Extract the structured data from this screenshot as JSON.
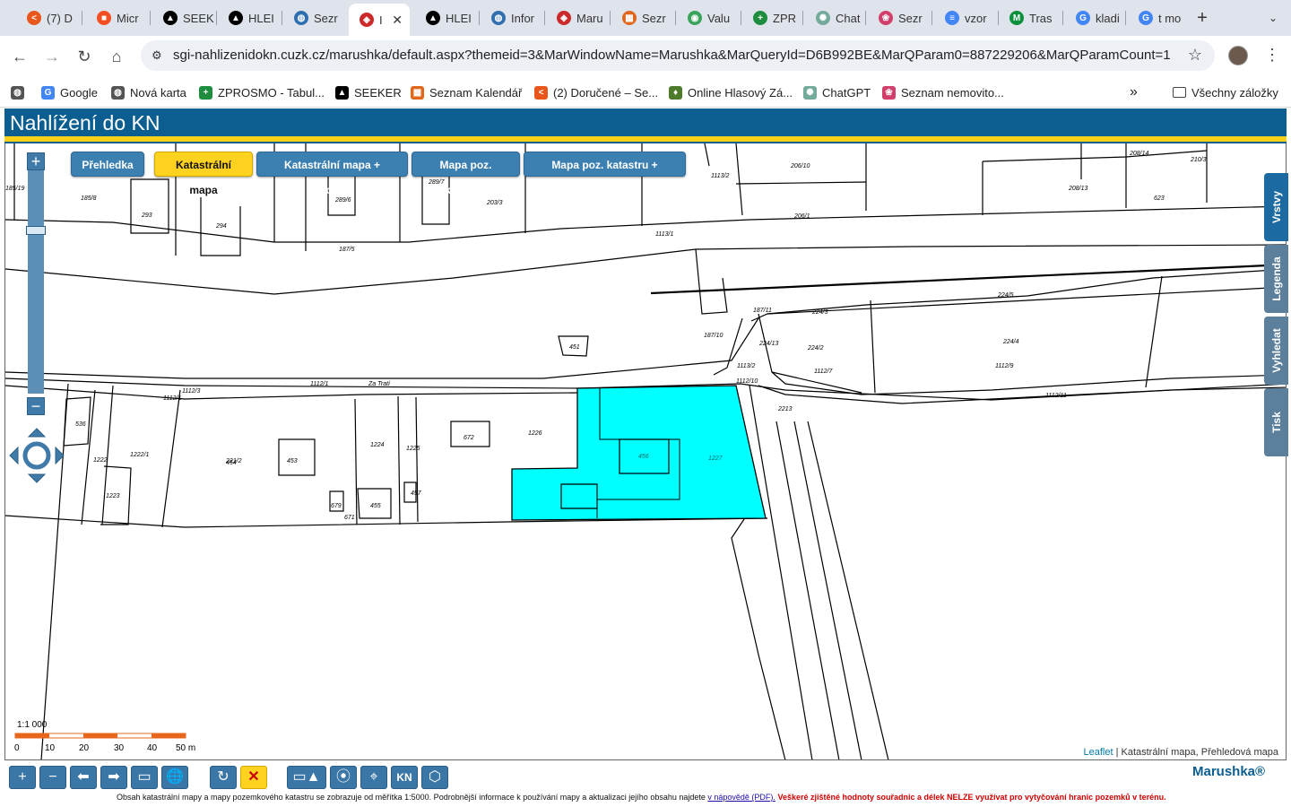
{
  "browser": {
    "tabs": [
      {
        "title": "(7) D",
        "favicon_color": "#e8561b",
        "glyph": "<"
      },
      {
        "title": "Micr",
        "favicon_color": "#f25022",
        "glyph": "■"
      },
      {
        "title": "SEEK",
        "favicon_color": "#000000",
        "glyph": "▲"
      },
      {
        "title": "HLEI",
        "favicon_color": "#000000",
        "glyph": "▲"
      },
      {
        "title": "Sezr",
        "favicon_color": "#2f6fb0",
        "glyph": "◍"
      },
      {
        "title": "I",
        "favicon_color": "#cc2a2a",
        "glyph": "◈"
      },
      {
        "title": "HLEI",
        "favicon_color": "#000000",
        "glyph": "▲"
      },
      {
        "title": "Infor",
        "favicon_color": "#2f6fb0",
        "glyph": "◍"
      },
      {
        "title": "Maru",
        "favicon_color": "#cc2a2a",
        "glyph": "◈"
      },
      {
        "title": "Sezr",
        "favicon_color": "#e0661b",
        "glyph": "▦"
      },
      {
        "title": "Valu",
        "favicon_color": "#3aa35b",
        "glyph": "◉"
      },
      {
        "title": "ZPR",
        "favicon_color": "#1e8e3e",
        "glyph": "+"
      },
      {
        "title": "Chat",
        "favicon_color": "#74aa9c",
        "glyph": "✺"
      },
      {
        "title": "Sezr",
        "favicon_color": "#d23f6b",
        "glyph": "❀"
      },
      {
        "title": "vzor",
        "favicon_color": "#4285f4",
        "glyph": "≡"
      },
      {
        "title": "Tras",
        "favicon_color": "#0a8f3c",
        "glyph": "M"
      },
      {
        "title": "kladi",
        "favicon_color": "#4285f4",
        "glyph": "G"
      },
      {
        "title": "t mo",
        "favicon_color": "#4285f4",
        "glyph": "G"
      }
    ],
    "active_tab_index": 5,
    "new_tab_label": "+",
    "tab_search_label": "⌄",
    "url": "sgi-nahlizenidokn.cuzk.cz/marushka/default.aspx?themeid=3&MarWindowName=Marushka&MarQueryId=D6B992BE&MarQParam0=887229206&MarQParamCount=1",
    "bookmarks": [
      {
        "label": "",
        "glyph": "◍",
        "color": "#555555"
      },
      {
        "label": "Google",
        "glyph": "G",
        "color": "#4285f4"
      },
      {
        "label": "Nová karta",
        "glyph": "◍",
        "color": "#555555"
      },
      {
        "label": "ZPROSMO - Tabul...",
        "glyph": "+",
        "color": "#1e8e3e"
      },
      {
        "label": "SEEKER",
        "glyph": "▲",
        "color": "#000000"
      },
      {
        "label": "Seznam Kalendář",
        "glyph": "▦",
        "color": "#e0661b"
      },
      {
        "label": "(2) Doručené – Se...",
        "glyph": "<",
        "color": "#e8561b"
      },
      {
        "label": "Online Hlasový Zá...",
        "glyph": "♦",
        "color": "#4e7a2b"
      },
      {
        "label": "ChatGPT",
        "glyph": "✺",
        "color": "#74aa9c"
      },
      {
        "label": "Seznam nemovito...",
        "glyph": "❀",
        "color": "#d23f6b"
      }
    ],
    "bookmarks_overflow": "»",
    "all_bookmarks": "Všechny záložky"
  },
  "app": {
    "title": "Nahlížení do KN",
    "layer_buttons": [
      {
        "label": "Přehledka",
        "active": false
      },
      {
        "label": "Katastrální mapa",
        "active": true
      },
      {
        "label": "Katastrální mapa + ortofoto",
        "active": false
      },
      {
        "label": "Mapa poz. katastru",
        "active": false
      },
      {
        "label": "Mapa poz. katastru + ortofoto",
        "active": false
      }
    ],
    "zoom_in": "+",
    "zoom_out": "−",
    "side_tabs": [
      "Vrstvy",
      "Legenda",
      "Vyhledat",
      "Tisk"
    ],
    "scale": {
      "ratio": "1:1 000",
      "ticks": [
        "0",
        "10",
        "20",
        "30",
        "40",
        "50 m"
      ]
    },
    "attribution": {
      "link": "Leaflet",
      "text": " | Katastrální mapa, Přehledová mapa"
    },
    "brand": "Marushka®",
    "footnote": {
      "text": "Obsah katastrální mapy a mapy pozemkového katastru se zobrazuje od měřítka 1:5000. Podrobnější informace k používání mapy a aktualizaci jejího obsahu najdete",
      "link": "v nápovědě (PDF).",
      "warning": "Veškeré zjištěné hodnoty souřadnic a délek NELZE využívat pro vytyčování hranic pozemků v terénu."
    },
    "map_labels": [
      "185/19",
      "185/8",
      "293",
      "294",
      "289/6",
      "289/7",
      "203/3",
      "187/5",
      "1113/2",
      "206/10",
      "206/1",
      "1113/1",
      "208/14",
      "210/3",
      "208/13",
      "623",
      "224/5",
      "224/3",
      "187/11",
      "224/2",
      "224/4",
      "187/10",
      "451",
      "224/13",
      "1113/2",
      "1112/7",
      "1112/9",
      "1112/10",
      "1112/1",
      "Za Tratí",
      "1112/3",
      "2213",
      "536",
      "1222",
      "1222/1",
      "221/2",
      "453",
      "1223",
      "454",
      "1224",
      "1225",
      "672",
      "1226",
      "456",
      "1227",
      "679",
      "671",
      "455",
      "457",
      "1112/1",
      "1112/11"
    ]
  },
  "colors": {
    "header_blue": "#0b5e8f",
    "accent_yellow": "#f7d117",
    "selected_parcel": "#00ffff",
    "button_blue": "#3c7fb1"
  }
}
